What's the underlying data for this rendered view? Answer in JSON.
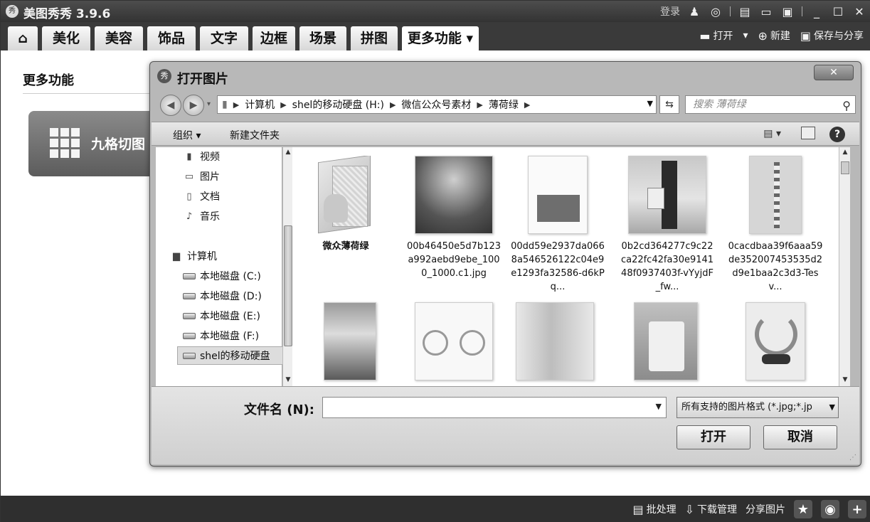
{
  "app": {
    "title": "美图秀秀 3.9.6",
    "logo_text": "秀",
    "login": "登录"
  },
  "tabs": [
    {
      "label": "美化"
    },
    {
      "label": "美容"
    },
    {
      "label": "饰品"
    },
    {
      "label": "文字"
    },
    {
      "label": "边框"
    },
    {
      "label": "场景"
    },
    {
      "label": "拼图"
    },
    {
      "label": "更多功能 ▾"
    }
  ],
  "tab_actions": {
    "open": "打开",
    "new": "新建",
    "save_share": "保存与分享"
  },
  "content": {
    "section_title": "更多功能",
    "nine_grid_label": "九格切图"
  },
  "statusbar": {
    "batch": "批处理",
    "download": "下载管理",
    "share": "分享图片"
  },
  "dialog": {
    "title": "打开图片",
    "breadcrumb": [
      "计算机",
      "shel的移动硬盘 (H:)",
      "微信公众号素材",
      "薄荷绿"
    ],
    "search_placeholder": "搜索 薄荷绿",
    "toolbar": {
      "organize": "组织 ▾",
      "new_folder": "新建文件夹"
    },
    "nav": {
      "videos": "视频",
      "pictures": "图片",
      "documents": "文档",
      "music": "音乐",
      "computer": "计算机",
      "drive_c": "本地磁盘 (C:)",
      "drive_d": "本地磁盘 (D:)",
      "drive_e": "本地磁盘 (E:)",
      "drive_f": "本地磁盘 (F:)",
      "drive_h": "shel的移动硬盘"
    },
    "files": [
      {
        "name": "微众薄荷绿",
        "type": "folder"
      },
      {
        "name": "00b46450e5d7b123a992aebd9ebe_1000_1000.c1.jpg",
        "type": "image"
      },
      {
        "name": "00dd59e2937da0668a546526122c04e9e1293fa32586-d6kPq...",
        "type": "image"
      },
      {
        "name": "0b2cd364277c9c22ca22fc42fa30e914148f0937403f-vYyjdF_fw...",
        "type": "image"
      },
      {
        "name": "0cacdbaa39f6aaa59de352007453535d2d9e1baa2c3d3-Tesv...",
        "type": "image"
      },
      {
        "name": "",
        "type": "image"
      },
      {
        "name": "",
        "type": "image"
      },
      {
        "name": "",
        "type": "image"
      },
      {
        "name": "",
        "type": "image"
      },
      {
        "name": "",
        "type": "image"
      }
    ],
    "filename_label": "文件名 (N):",
    "filename_value": "",
    "filter": "所有支持的图片格式 (*.jpg;*.jp",
    "open_button": "打开",
    "cancel_button": "取消"
  }
}
